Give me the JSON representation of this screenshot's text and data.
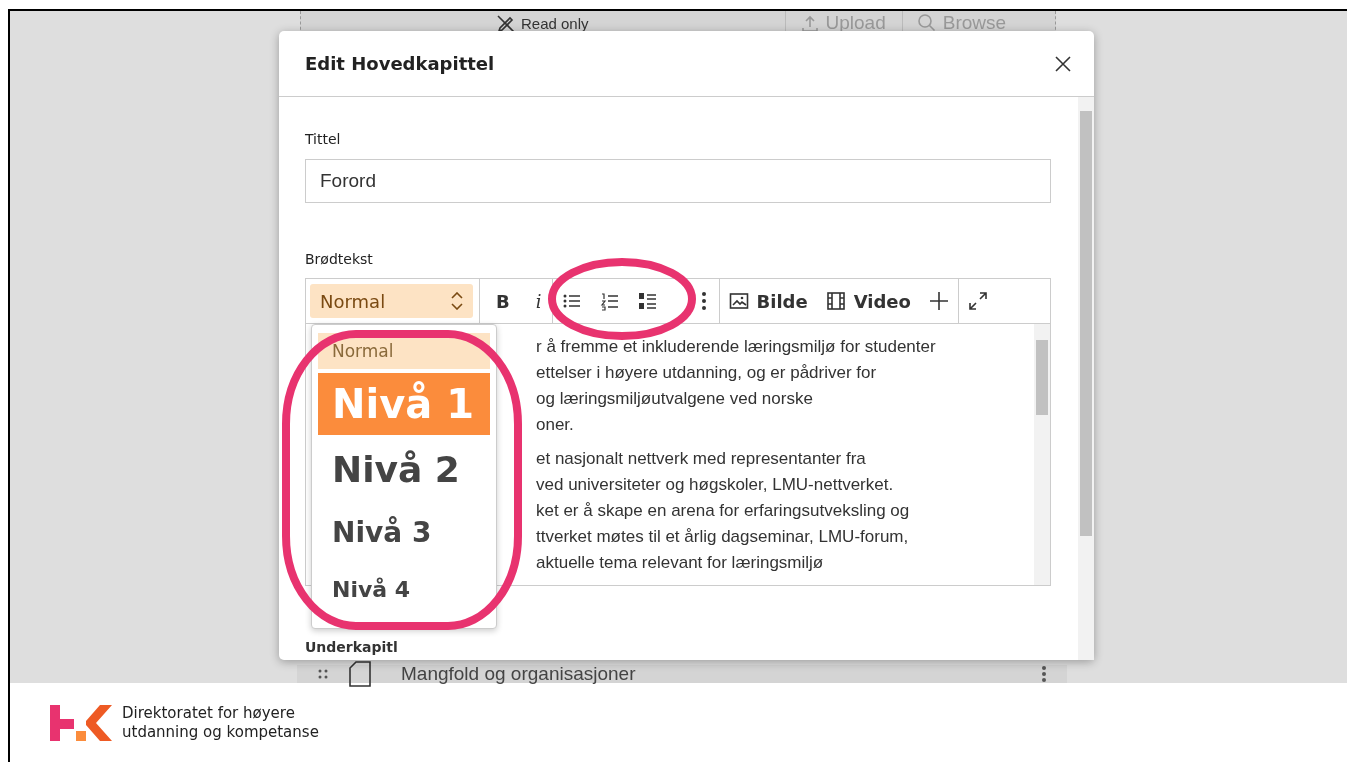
{
  "background": {
    "top_bar": [
      {
        "kind": "readonly",
        "label": "Read only",
        "disabled": false
      },
      {
        "kind": "upload",
        "label": "Upload",
        "disabled": true
      },
      {
        "kind": "browse",
        "label": "Browse",
        "disabled": true
      }
    ],
    "list_row": {
      "label": "Mangfold og organisasjoner"
    }
  },
  "dialog": {
    "title": "Edit Hovedkapittel",
    "title_field": {
      "label": "Tittel",
      "value": "Forord"
    },
    "body_label": "Brødtekst",
    "toolbar": [
      {
        "kind": "format",
        "label": "Normal"
      },
      {
        "kind": "bold",
        "label": "B"
      },
      {
        "kind": "italic",
        "label": "i"
      },
      {
        "kind": "bullets"
      },
      {
        "kind": "numbers"
      },
      {
        "kind": "alpha"
      },
      {
        "kind": "more"
      },
      {
        "kind": "image",
        "label": "Bilde"
      },
      {
        "kind": "video",
        "label": "Video"
      },
      {
        "kind": "plus"
      },
      {
        "kind": "expand"
      }
    ],
    "format_menu": [
      {
        "kind": "normal",
        "label": "Normal",
        "selected": true,
        "hovered": false
      },
      {
        "kind": "h1",
        "label": "Nivå 1",
        "selected": false,
        "hovered": true
      },
      {
        "kind": "h2",
        "label": "Nivå 2",
        "selected": false,
        "hovered": false
      },
      {
        "kind": "h3",
        "label": "Nivå 3",
        "selected": false,
        "hovered": false
      },
      {
        "kind": "h4",
        "label": "Nivå 4",
        "selected": false,
        "hovered": false
      }
    ],
    "editor_paragraphs": [
      [
        "r å fremme et inkluderende læringsmiljø for studenter",
        "ettelser i høyere utdanning, og er pådriver for",
        "og læringsmiljøutvalgene ved norske",
        "oner."
      ],
      [
        "et nasjonalt nettverk med representanter fra",
        "ved universiteter og høgskoler, LMU-nettverket.",
        "ket er å skape en arena for erfaringsutveksling og",
        "ttverket møtes til et årlig dagseminar, LMU-forum,",
        "aktuelle tema relevant for læringsmiljø"
      ]
    ],
    "section_label": "Underkapitl"
  },
  "footer": {
    "org_name": [
      "Direktoratet for høyere",
      "utdanning og kompetanse"
    ]
  }
}
